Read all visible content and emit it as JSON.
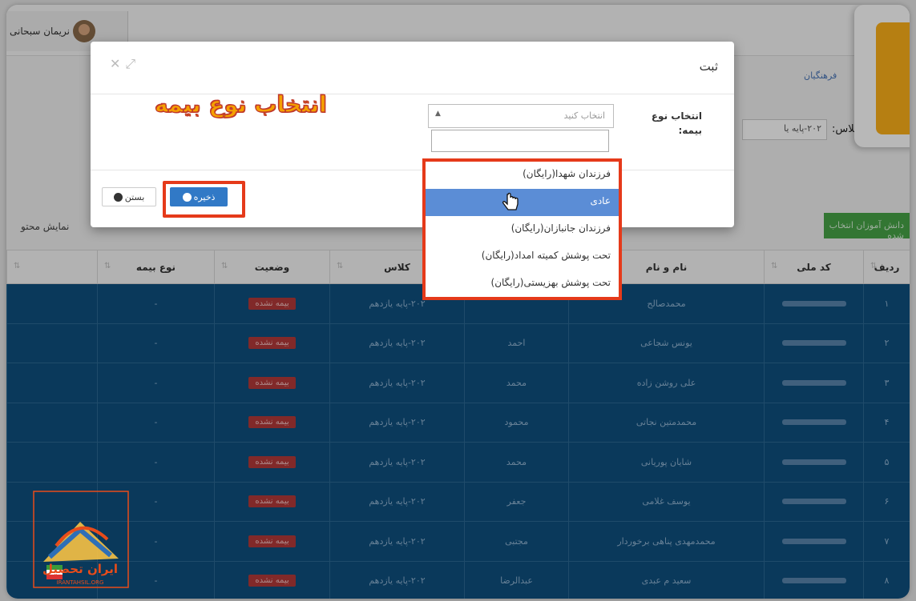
{
  "header": {
    "user_name": "نریمان سبحانی",
    "breadcrumb": "فرهنگیان",
    "class_label": "کلاس:",
    "class_value": "۲۰۲-پایه یا"
  },
  "toolbar": {
    "selected_students_button": "دانش آموزان انتخاب شده",
    "show_label": "نمایش محتو"
  },
  "table": {
    "headers": [
      "ردیف",
      "کد ملی",
      "نام و نام",
      "",
      "کلاس",
      "وضعیت",
      "نوع بیمه",
      ""
    ],
    "rows": [
      {
        "index": "۱",
        "last_name": "محمدصالح",
        "first_name": "",
        "class": "۲۰۲-پایه یازدهم",
        "status": "بیمه نشده",
        "insurance_type": "-"
      },
      {
        "index": "۲",
        "last_name": "یونس شجاعی",
        "first_name": "احمد",
        "class": "۲۰۲-پایه یازدهم",
        "status": "بیمه نشده",
        "insurance_type": "-"
      },
      {
        "index": "۳",
        "last_name": "علی روشن زاده",
        "first_name": "محمد",
        "class": "۲۰۲-پایه یازدهم",
        "status": "بیمه نشده",
        "insurance_type": "-"
      },
      {
        "index": "۴",
        "last_name": "محمدمتین نجاتی",
        "first_name": "محمود",
        "class": "۲۰۲-پایه یازدهم",
        "status": "بیمه نشده",
        "insurance_type": "-"
      },
      {
        "index": "۵",
        "last_name": "شایان پوریانی",
        "first_name": "محمد",
        "class": "۲۰۲-پایه یازدهم",
        "status": "بیمه نشده",
        "insurance_type": "-"
      },
      {
        "index": "۶",
        "last_name": "یوسف غلامی",
        "first_name": "جعفر",
        "class": "۲۰۲-پایه یازدهم",
        "status": "بیمه نشده",
        "insurance_type": "-"
      },
      {
        "index": "۷",
        "last_name": "محمدمهدی پناهی برخوردار",
        "first_name": "مجتبی",
        "class": "۲۰۲-پایه یازدهم",
        "status": "بیمه نشده",
        "insurance_type": "-"
      },
      {
        "index": "۸",
        "last_name": "سعید م عبدی",
        "first_name": "عبدالرضا",
        "class": "۲۰۲-پایه یازدهم",
        "status": "بیمه نشده",
        "insurance_type": "-"
      }
    ]
  },
  "modal": {
    "title": "ثبت",
    "field_label": "انتخاب نوع بیمه:",
    "select_placeholder": "انتخاب کنید",
    "annotation_headline": "انتخاب نوع بیمه",
    "save_button": "ذخیره",
    "close_button": "بستن",
    "options": [
      "فرزندان شهدا(رایگان)",
      "عادی",
      "فرزندان جانبازان(رایگان)",
      "تحت پوشش کمیته امداد(رایگان)",
      "تحت پوشش بهزیستی(رایگان)"
    ],
    "highlighted_option_index": 1
  },
  "watermark": {
    "name": "ایران تحصیل",
    "site": "IRANTAHSIL.ORG"
  },
  "colors": {
    "table_row_bg": "#0f4f7e",
    "status_badge": "#b33a3a",
    "save_button": "#3179c6",
    "highlight_border": "#e53a1a",
    "headline": "#f5a000",
    "selected_option": "#5b8dd6",
    "corner_accent": "#fdb019"
  }
}
